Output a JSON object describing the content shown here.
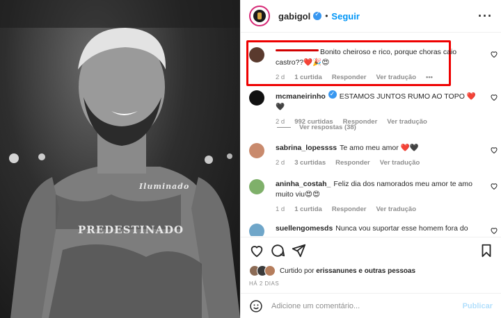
{
  "post": {
    "username": "gabigol",
    "follow_label": "Seguir",
    "separator": "•",
    "more_label": "···",
    "tattoo_word": "PREDESTINADO",
    "tattoo_script": "Iluminado"
  },
  "comments": [
    {
      "user": "",
      "text": "Bonito cheiroso e rico, porque choras caio castro??❤️🎉😍",
      "age": "2 d",
      "likes": "1 curtida",
      "reply": "Responder",
      "translate": "Ver tradução",
      "more": "•••",
      "avatar_color": "#5a3a2e"
    },
    {
      "user": "mcmaneirinho",
      "text": "ESTAMOS JUNTOS RUMO AO TOPO ❤️🖤",
      "age": "2 d",
      "likes": "992 curtidas",
      "reply": "Responder",
      "translate": "Ver tradução",
      "avatar_color": "#111111"
    },
    {
      "user": "sabrina_lopessss",
      "text": "Te amo meu amor ❤️🖤",
      "age": "2 d",
      "likes": "3 curtidas",
      "reply": "Responder",
      "translate": "Ver tradução",
      "avatar_color": "#c98a6d"
    },
    {
      "user": "aninha_costah_",
      "text": "Feliz dia dos namorados meu amor te amo muito viu😍😍",
      "age": "1 d",
      "likes": "1 curtida",
      "reply": "Responder",
      "translate": "Ver tradução",
      "avatar_color": "#7fb06a"
    },
    {
      "user": "suellengomesds",
      "text": "Nunca vou suportar esse homem fora do",
      "avatar_color": "#6fa6c9"
    }
  ],
  "replies_label": "Ver respostas (38)",
  "liked": {
    "prefix": "Curtido por ",
    "user": "erissanunes",
    "suffix": " e outras pessoas"
  },
  "timestamp": "HÁ 2 DIAS",
  "add_comment": {
    "placeholder": "Adicione um comentário...",
    "publish": "Publicar"
  },
  "colors": {
    "accent": "#0095f6",
    "highlight": "#e00000",
    "heart": "#ed4956"
  }
}
